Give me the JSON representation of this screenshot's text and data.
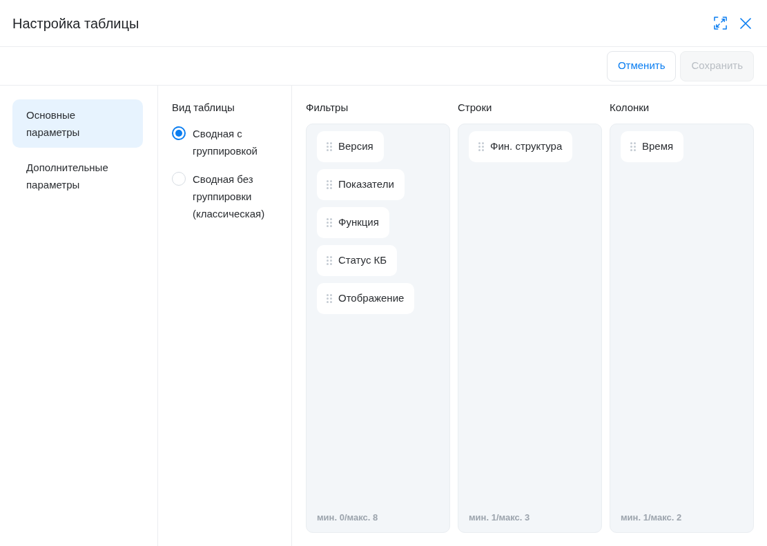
{
  "window": {
    "title": "Настройка таблицы"
  },
  "toolbar": {
    "buttons": [
      {
        "label": "Отменить",
        "disabled": false
      },
      {
        "label": "Сохранить",
        "disabled": true
      }
    ]
  },
  "sidebar": {
    "items": [
      {
        "label": "Основные параметры",
        "selected": true
      },
      {
        "label": "Дополнительные параметры",
        "selected": false
      }
    ]
  },
  "table_view": {
    "title": "Вид таблицы",
    "options": [
      {
        "label": "Сводная с группировкой",
        "selected": true
      },
      {
        "label": "Сводная без группировки (классическая)",
        "selected": false
      }
    ]
  },
  "zones": [
    {
      "title": "Фильтры",
      "items": [
        "Версия",
        "Показатели",
        "Функция",
        "Статус КБ",
        "Отображение"
      ],
      "limit": "мин. 0/макс. 8"
    },
    {
      "title": "Строки",
      "items": [
        "Фин. структура"
      ],
      "limit": "мин. 1/макс. 3"
    },
    {
      "title": "Колонки",
      "items": [
        "Время"
      ],
      "limit": "мин. 1/макс. 2"
    }
  ]
}
